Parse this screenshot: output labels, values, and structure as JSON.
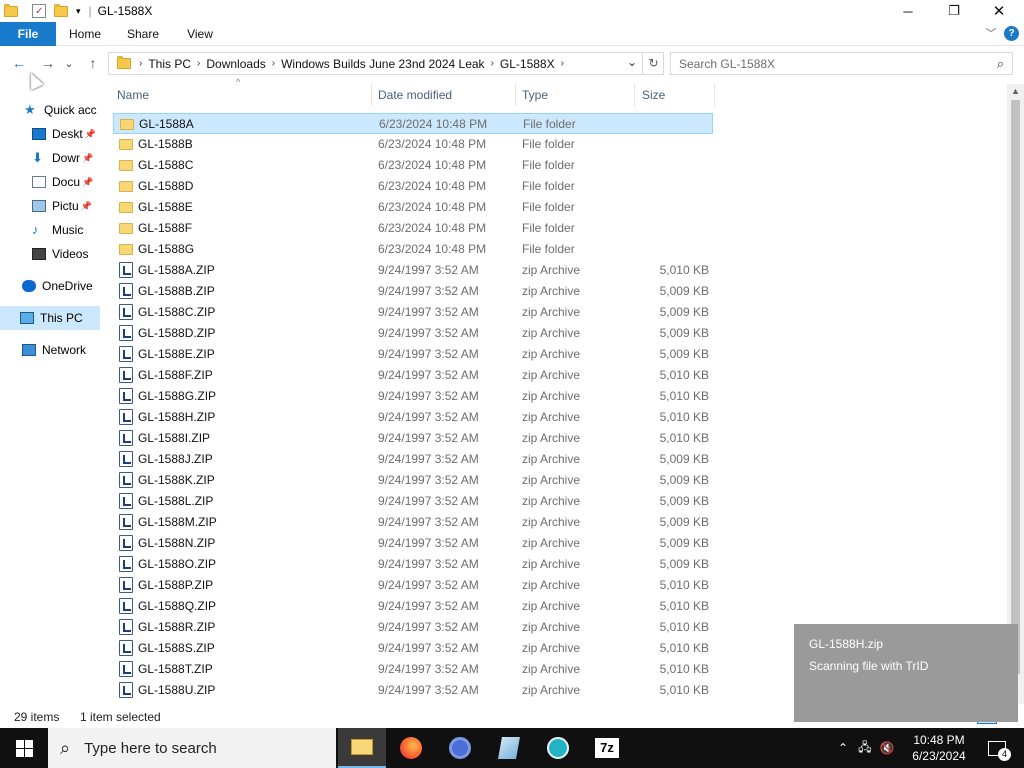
{
  "window": {
    "title": "GL-1588X",
    "minimize_glyph": "─",
    "maximize_glyph": "❐",
    "close_glyph": "✕"
  },
  "ribbon": {
    "tabs": [
      "File",
      "Home",
      "Share",
      "View"
    ],
    "expand_glyph": "﹀",
    "help_glyph": "?"
  },
  "address": {
    "crumbs": [
      "This PC",
      "Downloads",
      "Windows Builds June 23nd 2024 Leak",
      "GL-1588X"
    ],
    "dropdown_glyph": "⌄",
    "refresh_glyph": "↻"
  },
  "search": {
    "placeholder": "Search GL-1588X"
  },
  "navigation": {
    "back_glyph": "←",
    "forward_glyph": "→",
    "recent_glyph": "⌄",
    "up_glyph": "↑",
    "items": [
      {
        "label": "Quick acc",
        "icon": "star-icon",
        "pinned": false,
        "selected": false
      },
      {
        "label": "Deskt",
        "icon": "desktop-icon",
        "pinned": true,
        "selected": false
      },
      {
        "label": "Dowr",
        "icon": "download-icon",
        "pinned": true,
        "selected": false
      },
      {
        "label": "Docu",
        "icon": "document-icon",
        "pinned": true,
        "selected": false
      },
      {
        "label": "Pictu",
        "icon": "pictures-icon",
        "pinned": true,
        "selected": false
      },
      {
        "label": "Music",
        "icon": "music-icon",
        "pinned": false,
        "selected": false
      },
      {
        "label": "Videos",
        "icon": "videos-icon",
        "pinned": false,
        "selected": false
      },
      {
        "label": "OneDrive",
        "icon": "cloud-icon",
        "pinned": false,
        "selected": false
      },
      {
        "label": "This PC",
        "icon": "computer-icon",
        "pinned": false,
        "selected": true
      },
      {
        "label": "Network",
        "icon": "network-icon",
        "pinned": false,
        "selected": false
      }
    ]
  },
  "columns": {
    "name": "Name",
    "date": "Date modified",
    "type": "Type",
    "size": "Size",
    "sort_glyph": "^"
  },
  "files": [
    {
      "name": "GL-1588A",
      "date": "6/23/2024 10:48 PM",
      "type": "File folder",
      "size": "",
      "kind": "folder",
      "selected": true
    },
    {
      "name": "GL-1588B",
      "date": "6/23/2024 10:48 PM",
      "type": "File folder",
      "size": "",
      "kind": "folder",
      "selected": false
    },
    {
      "name": "GL-1588C",
      "date": "6/23/2024 10:48 PM",
      "type": "File folder",
      "size": "",
      "kind": "folder",
      "selected": false
    },
    {
      "name": "GL-1588D",
      "date": "6/23/2024 10:48 PM",
      "type": "File folder",
      "size": "",
      "kind": "folder",
      "selected": false
    },
    {
      "name": "GL-1588E",
      "date": "6/23/2024 10:48 PM",
      "type": "File folder",
      "size": "",
      "kind": "folder",
      "selected": false
    },
    {
      "name": "GL-1588F",
      "date": "6/23/2024 10:48 PM",
      "type": "File folder",
      "size": "",
      "kind": "folder",
      "selected": false
    },
    {
      "name": "GL-1588G",
      "date": "6/23/2024 10:48 PM",
      "type": "File folder",
      "size": "",
      "kind": "folder",
      "selected": false
    },
    {
      "name": "GL-1588A.ZIP",
      "date": "9/24/1997 3:52 AM",
      "type": "zip Archive",
      "size": "5,010 KB",
      "kind": "zip",
      "selected": false
    },
    {
      "name": "GL-1588B.ZIP",
      "date": "9/24/1997 3:52 AM",
      "type": "zip Archive",
      "size": "5,009 KB",
      "kind": "zip",
      "selected": false
    },
    {
      "name": "GL-1588C.ZIP",
      "date": "9/24/1997 3:52 AM",
      "type": "zip Archive",
      "size": "5,009 KB",
      "kind": "zip",
      "selected": false
    },
    {
      "name": "GL-1588D.ZIP",
      "date": "9/24/1997 3:52 AM",
      "type": "zip Archive",
      "size": "5,009 KB",
      "kind": "zip",
      "selected": false
    },
    {
      "name": "GL-1588E.ZIP",
      "date": "9/24/1997 3:52 AM",
      "type": "zip Archive",
      "size": "5,009 KB",
      "kind": "zip",
      "selected": false
    },
    {
      "name": "GL-1588F.ZIP",
      "date": "9/24/1997 3:52 AM",
      "type": "zip Archive",
      "size": "5,010 KB",
      "kind": "zip",
      "selected": false
    },
    {
      "name": "GL-1588G.ZIP",
      "date": "9/24/1997 3:52 AM",
      "type": "zip Archive",
      "size": "5,010 KB",
      "kind": "zip",
      "selected": false
    },
    {
      "name": "GL-1588H.ZIP",
      "date": "9/24/1997 3:52 AM",
      "type": "zip Archive",
      "size": "5,010 KB",
      "kind": "zip",
      "selected": false
    },
    {
      "name": "GL-1588I.ZIP",
      "date": "9/24/1997 3:52 AM",
      "type": "zip Archive",
      "size": "5,010 KB",
      "kind": "zip",
      "selected": false
    },
    {
      "name": "GL-1588J.ZIP",
      "date": "9/24/1997 3:52 AM",
      "type": "zip Archive",
      "size": "5,009 KB",
      "kind": "zip",
      "selected": false
    },
    {
      "name": "GL-1588K.ZIP",
      "date": "9/24/1997 3:52 AM",
      "type": "zip Archive",
      "size": "5,009 KB",
      "kind": "zip",
      "selected": false
    },
    {
      "name": "GL-1588L.ZIP",
      "date": "9/24/1997 3:52 AM",
      "type": "zip Archive",
      "size": "5,009 KB",
      "kind": "zip",
      "selected": false
    },
    {
      "name": "GL-1588M.ZIP",
      "date": "9/24/1997 3:52 AM",
      "type": "zip Archive",
      "size": "5,009 KB",
      "kind": "zip",
      "selected": false
    },
    {
      "name": "GL-1588N.ZIP",
      "date": "9/24/1997 3:52 AM",
      "type": "zip Archive",
      "size": "5,009 KB",
      "kind": "zip",
      "selected": false
    },
    {
      "name": "GL-1588O.ZIP",
      "date": "9/24/1997 3:52 AM",
      "type": "zip Archive",
      "size": "5,009 KB",
      "kind": "zip",
      "selected": false
    },
    {
      "name": "GL-1588P.ZIP",
      "date": "9/24/1997 3:52 AM",
      "type": "zip Archive",
      "size": "5,010 KB",
      "kind": "zip",
      "selected": false
    },
    {
      "name": "GL-1588Q.ZIP",
      "date": "9/24/1997 3:52 AM",
      "type": "zip Archive",
      "size": "5,010 KB",
      "kind": "zip",
      "selected": false
    },
    {
      "name": "GL-1588R.ZIP",
      "date": "9/24/1997 3:52 AM",
      "type": "zip Archive",
      "size": "5,010 KB",
      "kind": "zip",
      "selected": false
    },
    {
      "name": "GL-1588S.ZIP",
      "date": "9/24/1997 3:52 AM",
      "type": "zip Archive",
      "size": "5,010 KB",
      "kind": "zip",
      "selected": false
    },
    {
      "name": "GL-1588T.ZIP",
      "date": "9/24/1997 3:52 AM",
      "type": "zip Archive",
      "size": "5,010 KB",
      "kind": "zip",
      "selected": false
    },
    {
      "name": "GL-1588U.ZIP",
      "date": "9/24/1997 3:52 AM",
      "type": "zip Archive",
      "size": "5,010 KB",
      "kind": "zip",
      "selected": false
    }
  ],
  "status": {
    "item_count": "29 items",
    "selection": "1 item selected"
  },
  "toast": {
    "title": "GL-1588H.zip",
    "message": "Scanning file with TrID"
  },
  "taskbar": {
    "search_placeholder": "Type here to search",
    "apps": [
      "File Explorer",
      "Firefox",
      "Chrome",
      "Notepad++",
      "Arduino",
      "7z"
    ],
    "seven_zip_label": "7z",
    "time": "10:48 PM",
    "date": "6/23/2024",
    "notification_count": "4"
  },
  "colors": {
    "accent": "#1979ca",
    "selection": "#cce8ff",
    "taskbar": "#101010"
  }
}
